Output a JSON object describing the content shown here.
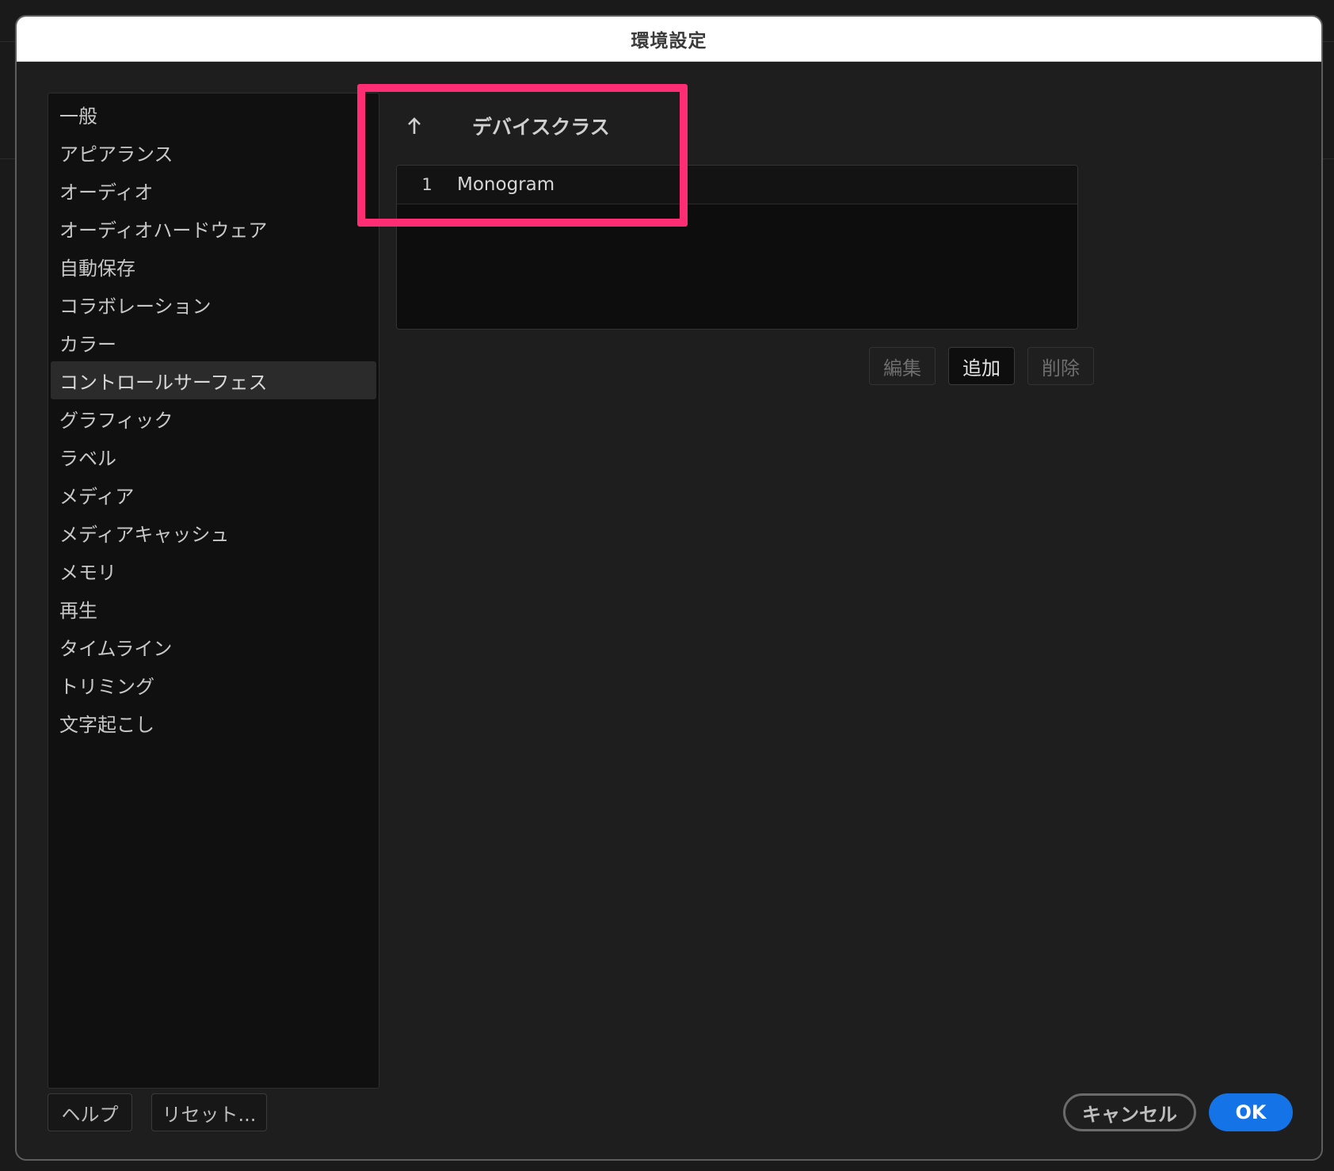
{
  "window": {
    "title": "環境設定"
  },
  "sidebar": {
    "items": [
      {
        "label": "一般"
      },
      {
        "label": "アピアランス"
      },
      {
        "label": "オーディオ"
      },
      {
        "label": "オーディオハードウェア"
      },
      {
        "label": "自動保存"
      },
      {
        "label": "コラボレーション"
      },
      {
        "label": "カラー"
      },
      {
        "label": "コントロールサーフェス",
        "selected": true
      },
      {
        "label": "グラフィック"
      },
      {
        "label": "ラベル"
      },
      {
        "label": "メディア"
      },
      {
        "label": "メディアキャッシュ"
      },
      {
        "label": "メモリ"
      },
      {
        "label": "再生"
      },
      {
        "label": "タイムライン"
      },
      {
        "label": "トリミング"
      },
      {
        "label": "文字起こし"
      }
    ]
  },
  "device_table": {
    "sort_icon": "arrow-up-icon",
    "column_title": "デバイスクラス",
    "rows": [
      {
        "index": "1",
        "name": "Monogram"
      }
    ]
  },
  "table_actions": {
    "edit_label": "編集",
    "add_label": "追加",
    "delete_label": "削除"
  },
  "footer": {
    "help_label": "ヘルプ",
    "reset_label": "リセット...",
    "cancel_label": "キャンセル",
    "ok_label": "OK"
  },
  "colors": {
    "highlight": "#ff2d74",
    "primary": "#1473e6",
    "selected_row": "#2b2b2b"
  }
}
